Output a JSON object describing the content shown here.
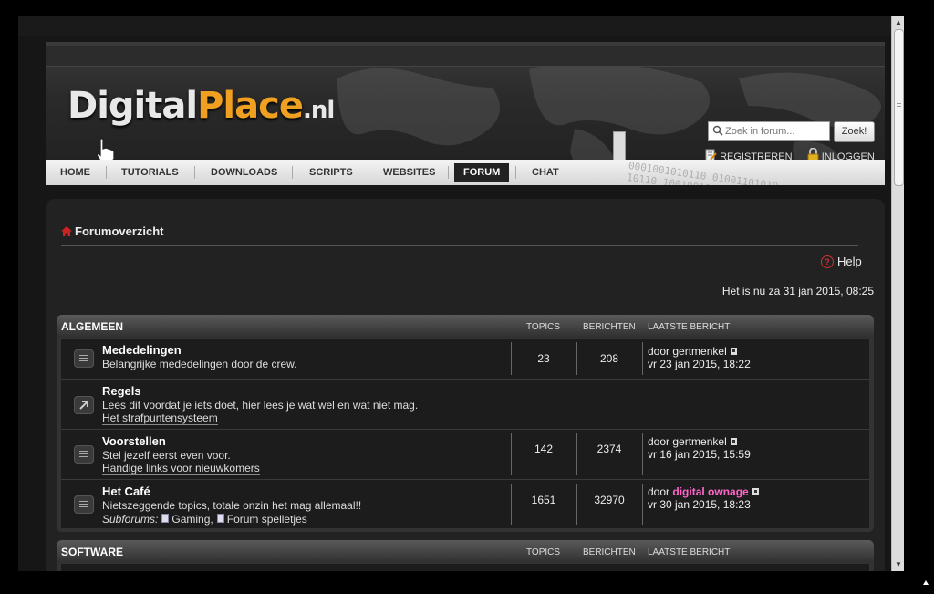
{
  "header": {
    "logo_digital": "Digital",
    "logo_place": "Place",
    "logo_tld": ".nl",
    "search_placeholder": "Zoek in forum...",
    "search_button": "Zoek!",
    "register_label": "REGISTREREN",
    "login_label": "INLOGGEN"
  },
  "nav": {
    "items": [
      "HOME",
      "TUTORIALS",
      "DOWNLOADS",
      "SCRIPTS",
      "WEBSITES",
      "FORUM",
      "CHAT"
    ],
    "active": "FORUM"
  },
  "breadcrumb": "Forumoverzicht",
  "help_label": "Help",
  "datetime": "Het is nu za 31 jan 2015, 08:25",
  "columns": {
    "topics": "TOPICS",
    "posts": "BERICHTEN",
    "last": "LAATSTE BERICHT"
  },
  "categories": [
    {
      "title": "ALGEMEEN",
      "forums": [
        {
          "name": "Mededelingen",
          "desc": "Belangrijke mededelingen door de crew.",
          "topics": "23",
          "posts": "208",
          "last_by_prefix": "door",
          "last_by": "gertmenkel",
          "last_date": "vr 23 jan 2015, 18:22"
        },
        {
          "name": "Regels",
          "desc": "Lees dit voordat je iets doet, hier lees je wat wel en wat niet mag.",
          "link": "Het strafpuntensysteem"
        },
        {
          "name": "Voorstellen",
          "desc": "Stel jezelf eerst even voor.",
          "link": "Handige links voor nieuwkomers",
          "topics": "142",
          "posts": "2374",
          "last_by_prefix": "door",
          "last_by": "gertmenkel",
          "last_date": "vr 16 jan 2015, 15:59"
        },
        {
          "name": "Het Café",
          "desc": "Nietszeggende topics, totale onzin het mag allemaal!!",
          "subforums_label": "Subforums:",
          "subforum_1": "Gaming",
          "subforum_sep": ",",
          "subforum_2": "Forum spelletjes",
          "topics": "1651",
          "posts": "32970",
          "last_by_prefix": "door",
          "last_by": "digital ownage",
          "last_date": "vr 30 jan 2015, 18:23"
        }
      ]
    },
    {
      "title": "SOFTWARE"
    }
  ],
  "colors": {
    "accent_orange": "#f0a020",
    "admin_pink": "#ff66cc",
    "home_red": "#cc2222"
  }
}
